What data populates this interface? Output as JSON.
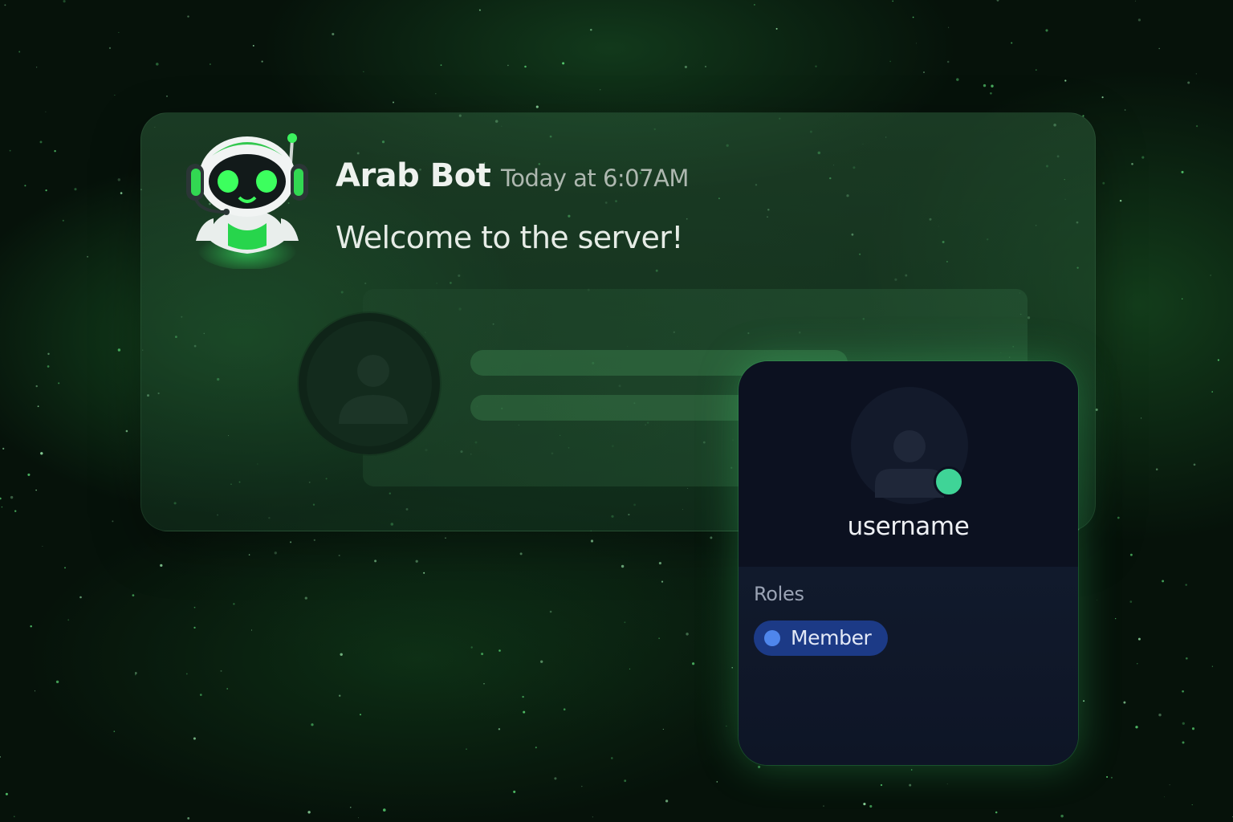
{
  "message": {
    "author": "Arab Bot",
    "timestamp": "Today at 6:07AM",
    "content": "Welcome to the server!",
    "bot_avatar_icon": "robot-headset-icon"
  },
  "profile_popup": {
    "username": "username",
    "status": "online",
    "roles_heading": "Roles",
    "roles": [
      {
        "name": "Member",
        "color": "#4f86ec"
      }
    ]
  },
  "colors": {
    "accent_green": "#2ee05a",
    "status_online": "#3fd497",
    "role_pill": "#1c3a86"
  }
}
